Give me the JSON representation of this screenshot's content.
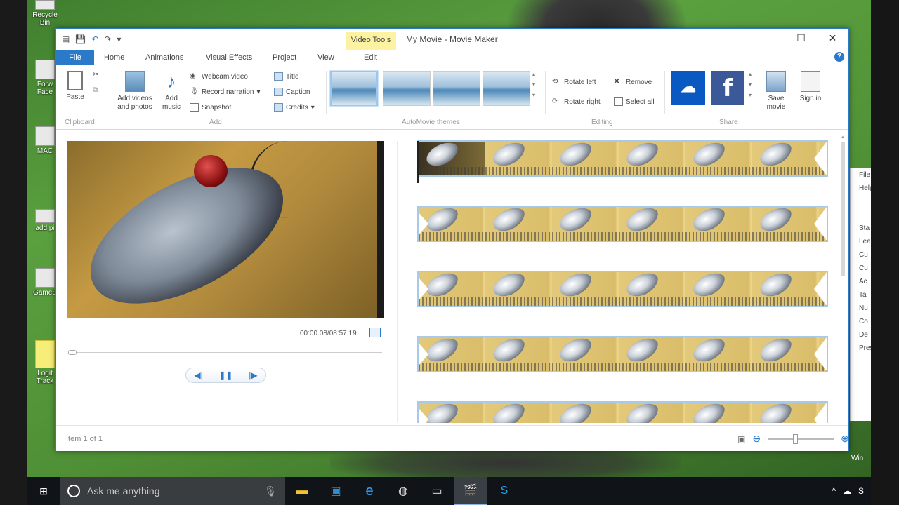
{
  "desktop": {
    "icons": [
      "Recycle Bin",
      "Forw Face",
      "MAC",
      "add pi",
      "GameS",
      "Logit Track"
    ],
    "corner_text": "Win"
  },
  "window": {
    "context_tab": "Video Tools",
    "title": "My Movie - Movie Maker",
    "controls": [
      "–",
      "☐",
      "✕"
    ]
  },
  "tabs": [
    "File",
    "Home",
    "Animations",
    "Visual Effects",
    "Project",
    "View",
    "Edit"
  ],
  "ribbon": {
    "clipboard": {
      "paste": "Paste",
      "label": "Clipboard"
    },
    "add": {
      "add_videos": "Add videos and photos",
      "add_music": "Add music",
      "webcam": "Webcam video",
      "narration": "Record narration",
      "snapshot": "Snapshot",
      "title": "Title",
      "caption": "Caption",
      "credits": "Credits",
      "label": "Add"
    },
    "themes_label": "AutoMovie themes",
    "editing": {
      "rotate_left": "Rotate left",
      "rotate_right": "Rotate right",
      "remove": "Remove",
      "select_all": "Select all",
      "label": "Editing"
    },
    "share": {
      "save_movie": "Save movie",
      "sign_in": "Sign in",
      "label": "Share"
    }
  },
  "player": {
    "timecode": "00:00.08/08:57.19",
    "prev": "◀|",
    "play_pause": "❚❚",
    "next": "|▶",
    "position_fraction": 0.0
  },
  "storyboard": {
    "clip_count": 5
  },
  "status": {
    "item_text": "Item 1 of 1"
  },
  "peek": [
    "File",
    "Help",
    "",
    "",
    "Sta",
    "Lea",
    "Cu",
    "Cu",
    "Ac",
    "Ta",
    "Nu",
    "Co",
    "De",
    "Press"
  ],
  "taskbar": {
    "search_placeholder": "Ask me anything"
  },
  "colors": {
    "accent": "#2b79c9",
    "context_tab": "#fdf2a2",
    "clip_border": "#a9c9e8"
  }
}
